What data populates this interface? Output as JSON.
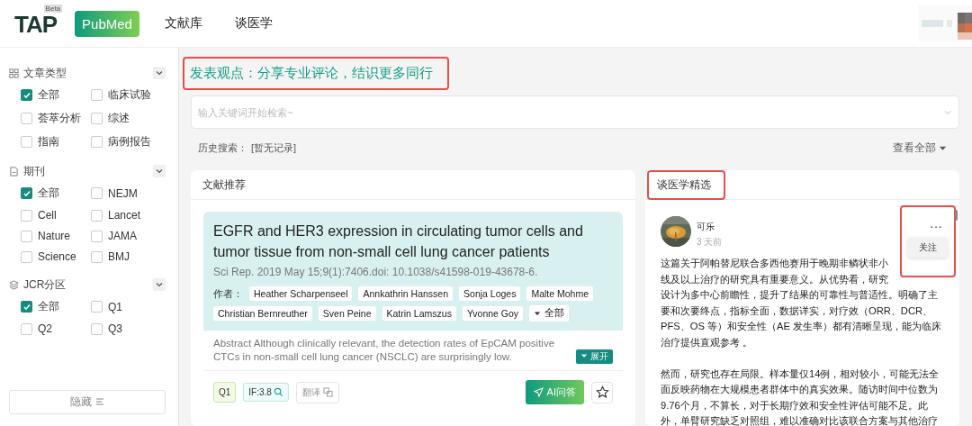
{
  "header": {
    "logo": "TAP",
    "logo_badge": "Beta",
    "nav": [
      {
        "label": "PubMed",
        "selected": true
      },
      {
        "label": "文献库",
        "selected": false
      },
      {
        "label": "谈医学",
        "selected": false
      }
    ]
  },
  "sidebar": {
    "sections": [
      {
        "title": "文章类型",
        "options": [
          {
            "label": "全部",
            "checked": true
          },
          {
            "label": "临床试验",
            "checked": false
          },
          {
            "label": "荟萃分析",
            "checked": false
          },
          {
            "label": "综述",
            "checked": false
          },
          {
            "label": "指南",
            "checked": false
          },
          {
            "label": "病例报告",
            "checked": false
          }
        ]
      },
      {
        "title": "期刊",
        "options": [
          {
            "label": "全部",
            "checked": true
          },
          {
            "label": "NEJM",
            "checked": false
          },
          {
            "label": "Cell",
            "checked": false
          },
          {
            "label": "Lancet",
            "checked": false
          },
          {
            "label": "Nature",
            "checked": false
          },
          {
            "label": "JAMA",
            "checked": false
          },
          {
            "label": "Science",
            "checked": false
          },
          {
            "label": "BMJ",
            "checked": false
          }
        ]
      },
      {
        "title": "JCR分区",
        "options": [
          {
            "label": "全部",
            "checked": true
          },
          {
            "label": "Q1",
            "checked": false
          },
          {
            "label": "Q2",
            "checked": false
          },
          {
            "label": "Q3",
            "checked": false
          }
        ]
      }
    ],
    "hide_button": "隐藏"
  },
  "main": {
    "headline": "发表观点：分享专业评论，结识更多同行",
    "search": {
      "placeholder": "输入关键词开始检索~"
    },
    "history": {
      "label": "历史搜索：",
      "value": "[暂无记录]",
      "view_all": "查看全部"
    },
    "recommend": {
      "title": "文献推荐",
      "article": {
        "title": "EGFR and HER3 expression in circulating tumor cells and tumor tissue from non-small cell lung cancer patients",
        "citation": "Sci Rep. 2019 May 15;9(1):7406.doi: 10.1038/s41598-019-43678-6.",
        "authors_label": "作者：",
        "authors": [
          "Heather Scharpenseel",
          "Annkathrin Hanssen",
          "Sonja Loges",
          "Malte Mohme",
          "Christian Bernreuther",
          "Sven Peine",
          "Katrin Lamszus",
          "Yvonne Goy"
        ],
        "authors_more": "全部",
        "abstract": "Abstract Although clinically relevant, the detection rates of EpCAM positive CTCs in non-small cell lung cancer (NSCLC) are surprisingly low.",
        "expand": "展开",
        "quartile": "Q1",
        "impact": "IF:3.8",
        "translate": "翻译",
        "ai": "AI问答"
      }
    },
    "picks": {
      "title": "谈医学精选",
      "post": {
        "author": "可乐",
        "time": "3 天前",
        "menu": "···",
        "menu_item": "关注",
        "paragraphs": [
          "这篇关于阿帕替尼联合多西他赛用于晚期非鳞状非小线及以上治疗的研究具有重要意义。从优势看，研究设计为多中心前瞻性，提升了结果的可靠性与普适性。明确了主要和次要终点，指标全面，数据详实，对疗效（ORR、DCR、PFS、OS 等）和安全性（AE 发生率）都有清晰呈现，能为临床治疗提供直观参考 。",
          "然而，研究也存在局限。样本量仅14例，相对较小，可能无法全面反映药物在大规模患者群体中的真实效果。随访时间中位数为9.76个月，不算长，对于长期疗效和安全性评估可能不足。此外，单臂研究缺乏对照组，难以准确对比该联合方案与其他治疗"
        ]
      }
    }
  }
}
